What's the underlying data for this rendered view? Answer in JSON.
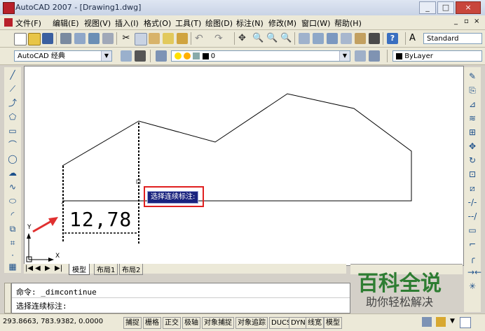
{
  "window": {
    "title": "AutoCAD 2007 - [Drawing1.dwg]",
    "controls": [
      "_",
      "□",
      "×"
    ],
    "doc_controls": [
      "_",
      "▫",
      "×"
    ]
  },
  "menu": [
    "文件(F)",
    "编辑(E)",
    "视图(V)",
    "插入(I)",
    "格式(O)",
    "工具(T)",
    "绘图(D)",
    "标注(N)",
    "修改(M)",
    "窗口(W)",
    "帮助(H)"
  ],
  "toolbar": {
    "text_style": "Standard",
    "workspace": "AutoCAD 经典",
    "layer": "0",
    "color": "ByLayer"
  },
  "drawing": {
    "dimension_text": "12,78",
    "tooltip": "选择连续标注:",
    "ucs_x": "X",
    "ucs_y": "Y"
  },
  "tabs": [
    "模型",
    "布局1",
    "布局2"
  ],
  "nav": [
    "|◀",
    "◀",
    "▶",
    "▶|"
  ],
  "command": {
    "line1": "命令: _dimcontinue",
    "line2": "选择连续标注:"
  },
  "status": {
    "coords": "293.8663,  783.9382,  0.0000",
    "buttons": [
      "捕捉",
      "栅格",
      "正交",
      "极轴",
      "对象捕捉",
      "对象追踪",
      "DUCS",
      "DYN",
      "线宽",
      "模型"
    ]
  },
  "watermark": {
    "title": "百科全说",
    "subtitle": "助你轻松解决"
  },
  "colors": {
    "tooltip_bg": "#1a237e",
    "highlight_box": "#e02020",
    "arrow": "#e03030",
    "watermark_green": "#2e7d32"
  }
}
